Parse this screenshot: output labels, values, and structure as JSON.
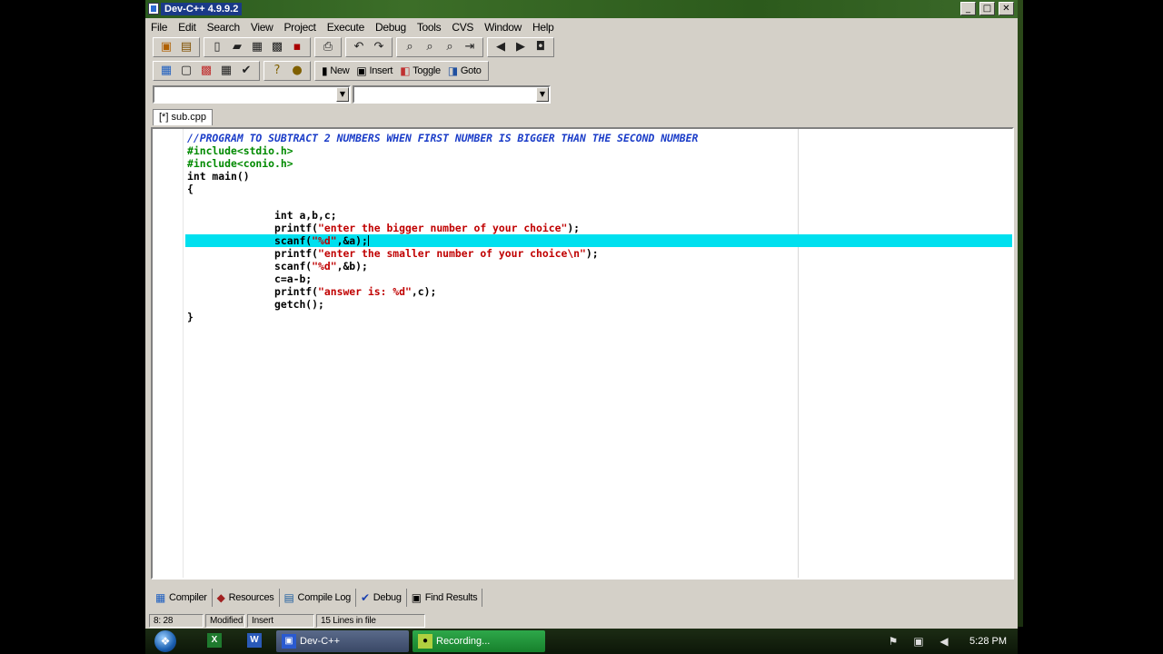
{
  "window": {
    "title": "Dev-C++ 4.9.9.2",
    "controls": {
      "minimize": "_",
      "maximize": "□",
      "close": "✕"
    }
  },
  "menu": [
    "File",
    "Edit",
    "Search",
    "View",
    "Project",
    "Execute",
    "Debug",
    "Tools",
    "CVS",
    "Window",
    "Help"
  ],
  "toolbar2": {
    "new_label": "New",
    "insert_label": "Insert",
    "toggle_label": "Toggle",
    "goto_label": "Goto"
  },
  "file_tab": {
    "label": "[*] sub.cpp"
  },
  "editor": {
    "lines": [
      "//PROGRAM TO SUBTRACT 2 NUMBERS WHEN FIRST NUMBER IS BIGGER THAN THE SECOND NUMBER",
      "#include<stdio.h>",
      "#include<conio.h>",
      "int main()",
      "{",
      "",
      "              int a,b,c;",
      "              printf(\"enter the bigger number of your choice\");",
      "              scanf(\"%d\",&a);",
      "              printf(\"enter the smaller number of your choice\\n\");",
      "              scanf(\"%d\",&b);",
      "              c=a-b;",
      "              printf(\"answer is: %d\",c);",
      "              getch();",
      "}"
    ],
    "active_line": 9
  },
  "bottom_tabs": [
    "Compiler",
    "Resources",
    "Compile Log",
    "Debug",
    "Find Results"
  ],
  "status": {
    "position": "8: 28",
    "modified": "Modified",
    "mode": "Insert",
    "lines": "15 Lines in file"
  },
  "taskbar": {
    "buttons": [
      "Dev-C++",
      "Recording..."
    ],
    "clock": "5:28 PM"
  },
  "colors": {
    "active_line": "#00e0ef",
    "comment": "#1a3cc8",
    "string": "#c00000",
    "window_face": "#d4d0c8"
  }
}
